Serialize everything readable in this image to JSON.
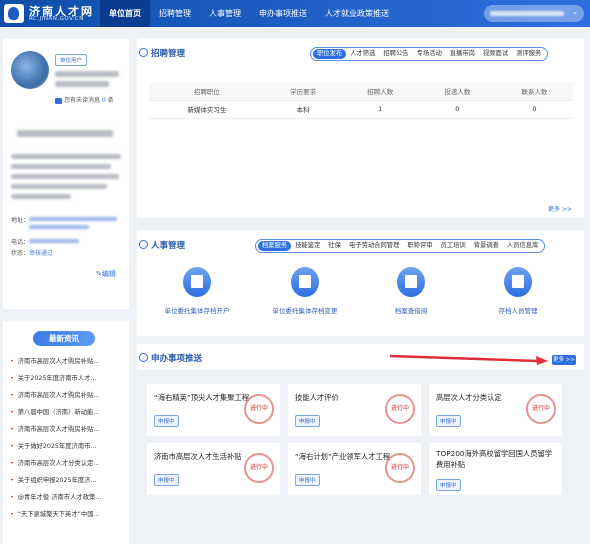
{
  "header": {
    "logo_cn": "济南人才网",
    "logo_en": "RC.JINAN.GOV.CN",
    "nav": [
      "单位首页",
      "招聘管理",
      "人事管理",
      "申办事项推送",
      "人才就业政策推送"
    ]
  },
  "profile": {
    "unit_tag": "单位用户",
    "msg_prefix": "您有未读消息",
    "msg_count": "0",
    "msg_suffix": "条",
    "addr_label": "地址：",
    "phone_label": "电话：",
    "status_label": "状态：",
    "status_value": "审核通过",
    "edit_label": "编辑"
  },
  "news": {
    "title": "最新资讯",
    "items": [
      "济南市高层次人才购房补贴...",
      "关于2025年度济南市人才...",
      "济南市高层次人才购房补贴...",
      "第八届中国（济南）新动能...",
      "济南市高层次人才购房补贴...",
      "关于做好2025年度济南市...",
      "济南市高层次人才分类认定...",
      "关于组织申报2025年度济...",
      "@青年才俊 济南市人才政策...",
      "“天下泉城聚天下英才”中国..."
    ]
  },
  "recruit": {
    "title": "招聘管理",
    "tabs": [
      "职位发布",
      "人才筛选",
      "招聘公告",
      "专场活动",
      "直播带岗",
      "视频面试",
      "测评服务"
    ],
    "columns": [
      "招聘职位",
      "学历要求",
      "招聘人数",
      "投递人数",
      "联系人数"
    ],
    "rows": [
      [
        "新媒体实习生",
        "本科",
        "1",
        "0",
        "0"
      ]
    ],
    "more": "更多 >>"
  },
  "hr": {
    "title": "人事管理",
    "tabs": [
      "档案服务",
      "技能鉴定",
      "社保",
      "电子劳动合同管理",
      "职称评审",
      "员工培训",
      "背景调查",
      "人员信息库"
    ],
    "services": [
      "单位委托集体存档开户",
      "单位委托集体存档变更",
      "档案查借阅",
      "存档人员管理"
    ]
  },
  "push": {
    "title": "申办事项推送",
    "more": "更多 >>",
    "seal_text": "进行中",
    "cards": [
      {
        "title": "“海右精英”顶尖人才集聚工程",
        "tag": "申报中"
      },
      {
        "title": "技能人才评价",
        "tag": "申报中"
      },
      {
        "title": "高层次人才分类认定",
        "tag": "申报中"
      },
      {
        "title": "济南市高层次人才生活补贴",
        "tag": "申报中"
      },
      {
        "title": "“海右计划”产业领军人才工程",
        "tag": "申报中"
      },
      {
        "title": "TOP200海外高校留学回国人员留学",
        "title2": "费用补贴",
        "tag": "申报中"
      }
    ]
  },
  "colors": {
    "brand": "#2f6fe0",
    "header_dark": "#0a3d8f",
    "arrow": "#e02f3a"
  }
}
